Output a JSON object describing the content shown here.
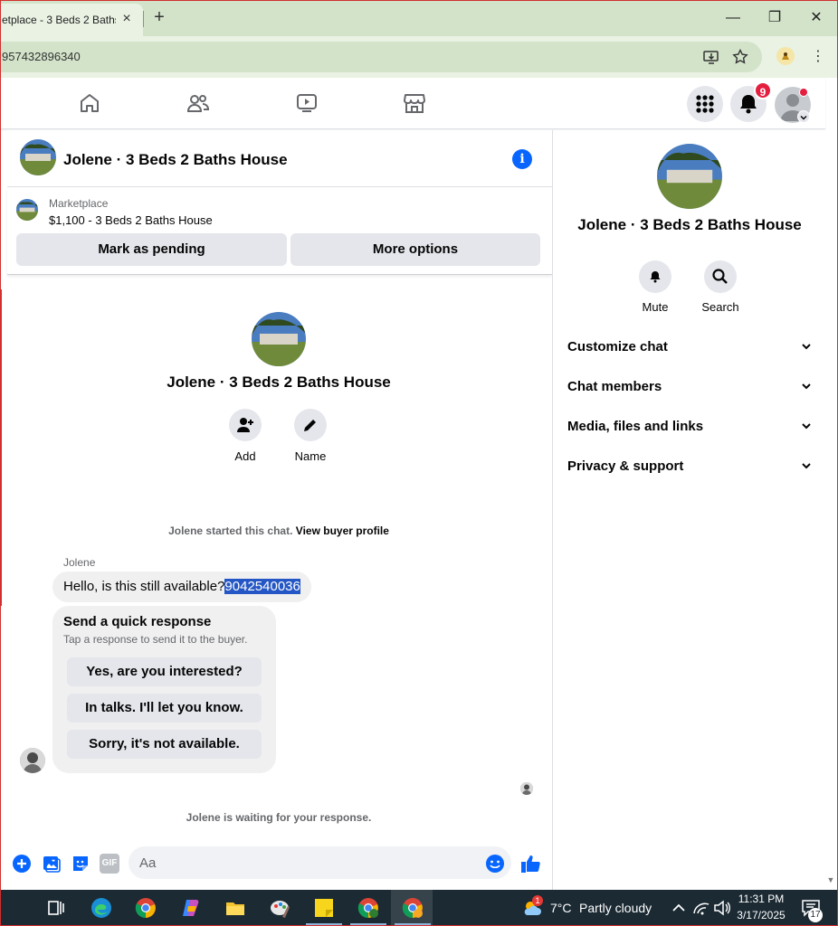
{
  "browser": {
    "tab_title": "etplace - 3 Beds 2 Baths",
    "new_tab": "+",
    "url": "957432896340",
    "window_controls": {
      "minimize": "—",
      "maximize": "❐",
      "close": "✕"
    },
    "menu": "⋮"
  },
  "fb_nav": {
    "icons": [
      "home-icon",
      "friends-icon",
      "video-icon",
      "marketplace-icon"
    ],
    "notification_count": "9"
  },
  "chat": {
    "title": "Jolene · 3 Beds 2 Baths House",
    "info_glyph": "i",
    "marketplace_label": "Marketplace",
    "listing": "$1,100 - 3 Beds 2 Baths House",
    "mark_pending": "Mark as pending",
    "more_options": "More options",
    "center_name": "Jolene · 3 Beds 2 Baths House",
    "add_label": "Add",
    "name_label": "Name",
    "started_prefix": "Jolene started this chat.",
    "view_profile": "View buyer profile",
    "sender": "Jolene",
    "message_text": "Hello, is this still available?",
    "message_selected": "9042540036",
    "quick_title": "Send a quick response",
    "quick_subtitle": "Tap a response to send it to the buyer.",
    "quick_responses": [
      "Yes, are you interested?",
      "In talks. I'll let you know.",
      "Sorry, it's not available."
    ],
    "waiting": "Jolene is waiting for your response.",
    "input_placeholder": "Aa",
    "gif_label": "GIF"
  },
  "right_panel": {
    "name": "Jolene · 3 Beds 2 Baths House",
    "mute": "Mute",
    "search": "Search",
    "sections": [
      "Customize chat",
      "Chat members",
      "Media, files and links",
      "Privacy & support"
    ]
  },
  "taskbar": {
    "weather_temp": "7°C",
    "weather_desc": "Partly cloudy",
    "weather_badge": "1",
    "time": "11:31 PM",
    "date": "3/17/2025",
    "notifications": "17"
  },
  "colors": {
    "accent": "#0866ff",
    "badge": "#e41e3f",
    "titlebar": "#d3e3c9",
    "taskbar": "#1b2a33"
  }
}
